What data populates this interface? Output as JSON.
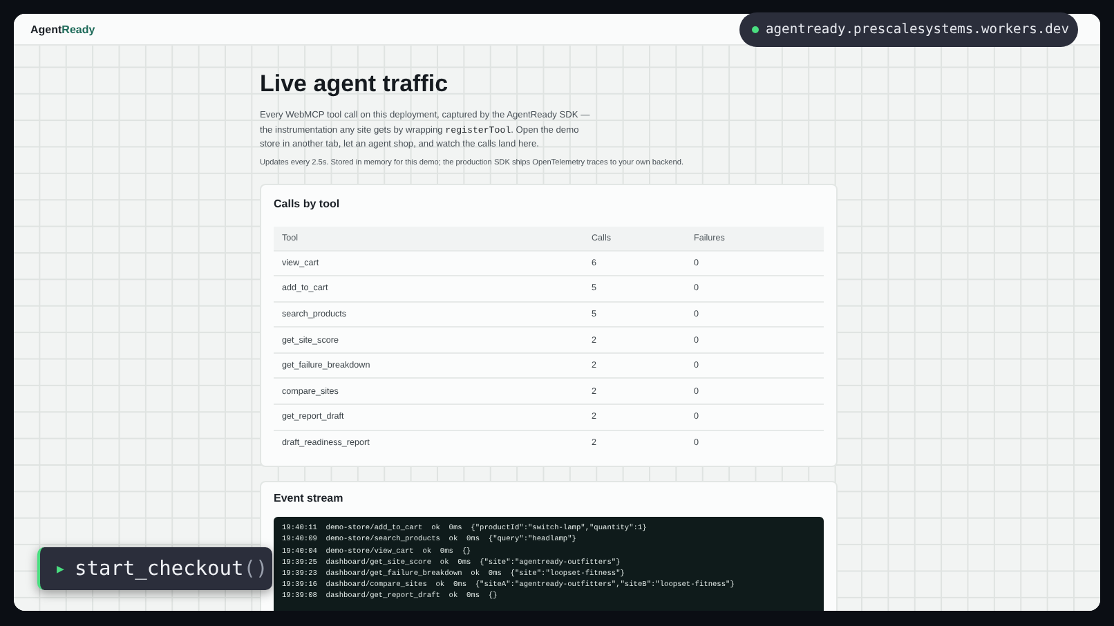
{
  "brand": {
    "first": "Agent",
    "second": "Ready"
  },
  "url_badge": {
    "text": "agentready.prescalesystems.workers.dev"
  },
  "title": "Live agent traffic",
  "intro": [
    {
      "kind": "text",
      "text": "Every WebMCP tool call on this deployment, captured by the AgentReady SDK — the instrumentation any site gets by wrapping "
    },
    {
      "kind": "code",
      "text": "registerTool"
    },
    {
      "kind": "text",
      "text": ". Open the demo store in another tab, let an agent shop, and watch the calls land here."
    }
  ],
  "note": "Updates every 2.5s. Stored in memory for this demo; the production SDK ships OpenTelemetry traces to your own backend.",
  "calls_card": {
    "title": "Calls by tool",
    "columns": [
      "Tool",
      "Calls",
      "Failures"
    ],
    "rows": [
      {
        "tool": "view_cart",
        "calls": "6",
        "failures": "0"
      },
      {
        "tool": "add_to_cart",
        "calls": "5",
        "failures": "0"
      },
      {
        "tool": "search_products",
        "calls": "5",
        "failures": "0"
      },
      {
        "tool": "get_site_score",
        "calls": "2",
        "failures": "0"
      },
      {
        "tool": "get_failure_breakdown",
        "calls": "2",
        "failures": "0"
      },
      {
        "tool": "compare_sites",
        "calls": "2",
        "failures": "0"
      },
      {
        "tool": "get_report_draft",
        "calls": "2",
        "failures": "0"
      },
      {
        "tool": "draft_readiness_report",
        "calls": "2",
        "failures": "0"
      }
    ]
  },
  "event_stream": {
    "title": "Event stream",
    "lines": [
      "19:40:11  demo-store/add_to_cart  ok  0ms  {\"productId\":\"switch-lamp\",\"quantity\":1}",
      "19:40:09  demo-store/search_products  ok  0ms  {\"query\":\"headlamp\"}",
      "19:40:04  demo-store/view_cart  ok  0ms  {}",
      "19:39:25  dashboard/get_site_score  ok  0ms  {\"site\":\"agentready-outfitters\"}",
      "19:39:23  dashboard/get_failure_breakdown  ok  0ms  {\"site\":\"loopset-fitness\"}",
      "19:39:16  dashboard/compare_sites  ok  0ms  {\"siteA\":\"agentready-outfitters\",\"siteB\":\"loopset-fitness\"}",
      "19:39:08  dashboard/get_report_draft  ok  0ms  {}"
    ]
  },
  "command_pill": {
    "icon": "▶",
    "name": "start_checkout",
    "parens": "()"
  }
}
